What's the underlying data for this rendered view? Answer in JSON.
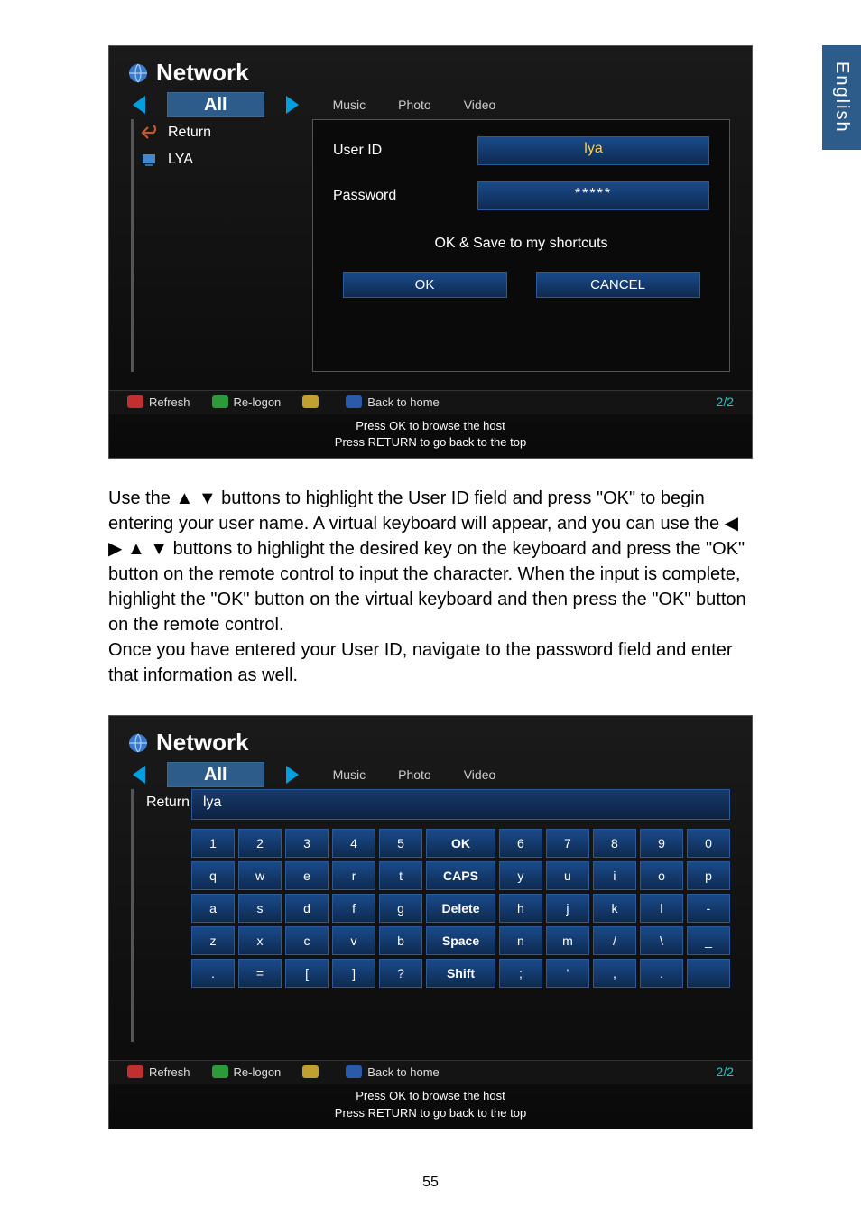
{
  "language_tab": "English",
  "instruction": "Use the ▲ ▼ buttons to highlight the User ID field and press \"OK\" to begin entering your user name. A virtual keyboard will appear, and you can use the ◀ ▶ ▲ ▼ buttons to highlight the desired key on the keyboard and press the \"OK\" button on the remote control to input the character. When the input is complete, highlight the \"OK\" button on the virtual keyboard and then press the \"OK\" button on the remote control.\nOnce you have entered your User ID, navigate to the password field and enter that information as well.",
  "screenshot1": {
    "title": "Network",
    "tabs": {
      "current": "All",
      "others": [
        "Music",
        "Photo",
        "Video"
      ]
    },
    "side": {
      "return": "Return",
      "item": "LYA"
    },
    "login": {
      "userid_label": "User ID",
      "userid_value": "lya",
      "password_label": "Password",
      "password_value": "*****",
      "save_text": "OK & Save to my shortcuts",
      "ok": "OK",
      "cancel": "CANCEL"
    },
    "footer": {
      "refresh": "Refresh",
      "relogon": "Re-logon",
      "back": "Back to home",
      "page": "2/2"
    },
    "hint1": "Press OK to browse the host",
    "hint2": "Press RETURN to go back to the top"
  },
  "screenshot2": {
    "title": "Network",
    "tabs": {
      "current": "All",
      "others": [
        "Music",
        "Photo",
        "Video"
      ]
    },
    "side": {
      "return": "Return"
    },
    "input_value": "lya",
    "keyboard": [
      [
        "1",
        "2",
        "3",
        "4",
        "5",
        "OK",
        "6",
        "7",
        "8",
        "9",
        "0"
      ],
      [
        "q",
        "w",
        "e",
        "r",
        "t",
        "CAPS",
        "y",
        "u",
        "i",
        "o",
        "p"
      ],
      [
        "a",
        "s",
        "d",
        "f",
        "g",
        "Delete",
        "h",
        "j",
        "k",
        "l",
        "-"
      ],
      [
        "z",
        "x",
        "c",
        "v",
        "b",
        "Space",
        "n",
        "m",
        "/",
        "\\",
        "_"
      ],
      [
        ".",
        "=",
        "[",
        "]",
        "?",
        "Shift",
        ";",
        "'",
        ",",
        ".",
        ""
      ]
    ],
    "footer": {
      "refresh": "Refresh",
      "relogon": "Re-logon",
      "back": "Back to home",
      "page": "2/2"
    },
    "hint1": "Press OK to browse the host",
    "hint2": "Press RETURN to go back to the top"
  },
  "page_number": "55"
}
